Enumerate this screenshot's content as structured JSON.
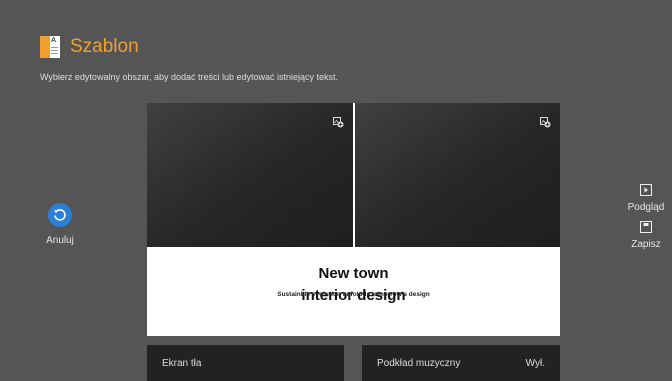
{
  "app": {
    "title": "Szablon",
    "instruction": "Wybierz edytowalny obszar, aby dodać treści lub edytować istniejący tekst.",
    "accent_color": "#f0a030"
  },
  "cancel": {
    "label": "Anuluj",
    "icon": "undo-icon",
    "color": "#2a7fd6"
  },
  "actions": {
    "preview": {
      "label": "Podgląd",
      "icon": "play-icon"
    },
    "save": {
      "label": "Zapisz",
      "icon": "save-icon"
    }
  },
  "template": {
    "heading_line1": "New town",
    "heading_line2": "interior design",
    "tagline": "Sustainble evolution unfolods tomorrow's design",
    "placeholder_icon": "add-image-icon"
  },
  "bottom": {
    "background_label": "Ekran tła",
    "music_label": "Podkład muzyczny",
    "music_value": "Wył."
  }
}
